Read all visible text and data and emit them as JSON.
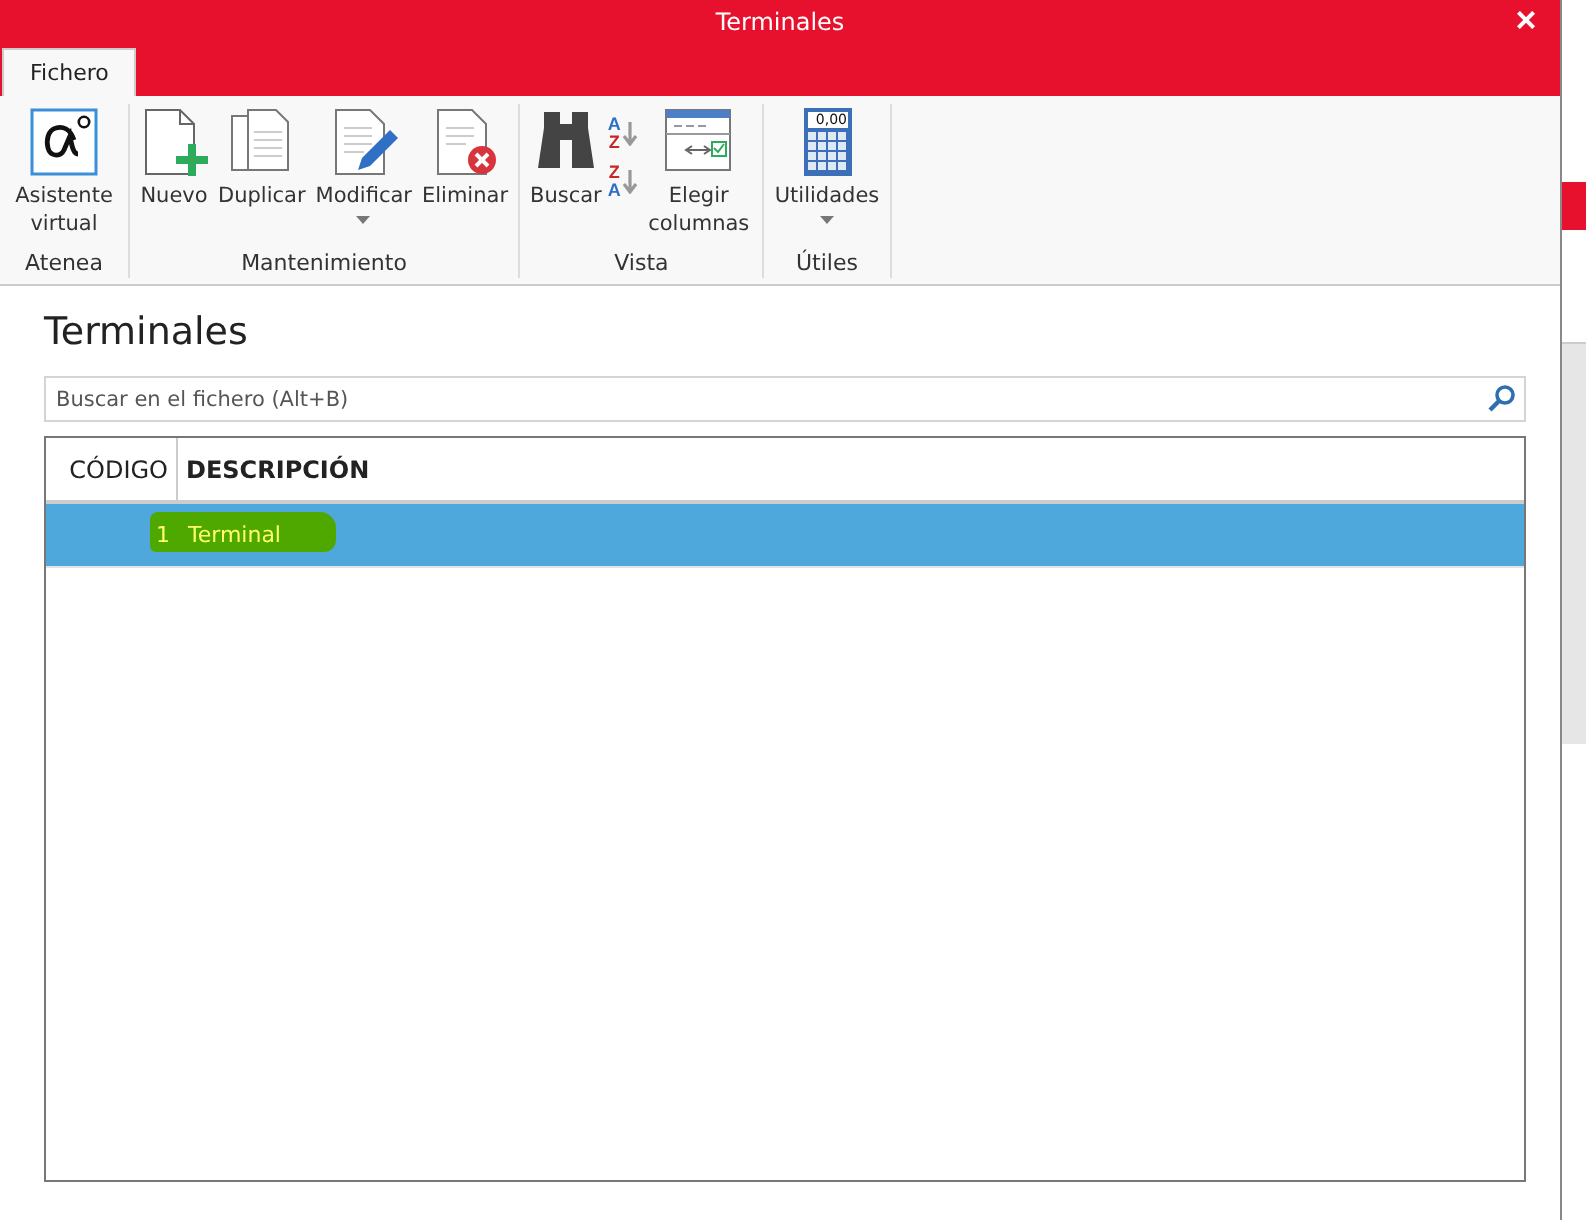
{
  "window": {
    "title": "Terminales",
    "close": "×"
  },
  "tabs": [
    {
      "label": "Fichero",
      "selected": true
    }
  ],
  "ribbon": [
    {
      "group": "Atenea",
      "buttons": [
        {
          "kind": "alpha",
          "label": "Asistente virtual",
          "dropdown": false
        }
      ]
    },
    {
      "group": "Mantenimiento",
      "buttons": [
        {
          "kind": "new",
          "label": "Nuevo",
          "dropdown": false
        },
        {
          "kind": "duplicate",
          "label": "Duplicar",
          "dropdown": false
        },
        {
          "kind": "edit",
          "label": "Modificar",
          "dropdown": true
        },
        {
          "kind": "delete",
          "label": "Eliminar",
          "dropdown": false
        }
      ]
    },
    {
      "group": "Vista",
      "buttons": [
        {
          "kind": "search",
          "label": "Buscar",
          "dropdown": false
        },
        {
          "kind": "sort",
          "letters": [
            "A",
            "Z",
            "Z",
            "A"
          ]
        },
        {
          "kind": "columns",
          "label": "Elegir columnas",
          "dropdown": false
        }
      ]
    },
    {
      "group": "Útiles",
      "buttons": [
        {
          "kind": "calculator",
          "label": "Utilidades",
          "display": "0,00",
          "dropdown": true
        }
      ]
    }
  ],
  "heading": "Terminales",
  "search": {
    "placeholder": "Buscar en el fichero (Alt+B)"
  },
  "table": {
    "columns": [
      "CÓDIGO",
      "DESCRIPCIÓN"
    ],
    "rows": [
      {
        "cells": [
          "1",
          "Terminal"
        ],
        "selected": true,
        "highlighted": true
      }
    ]
  }
}
